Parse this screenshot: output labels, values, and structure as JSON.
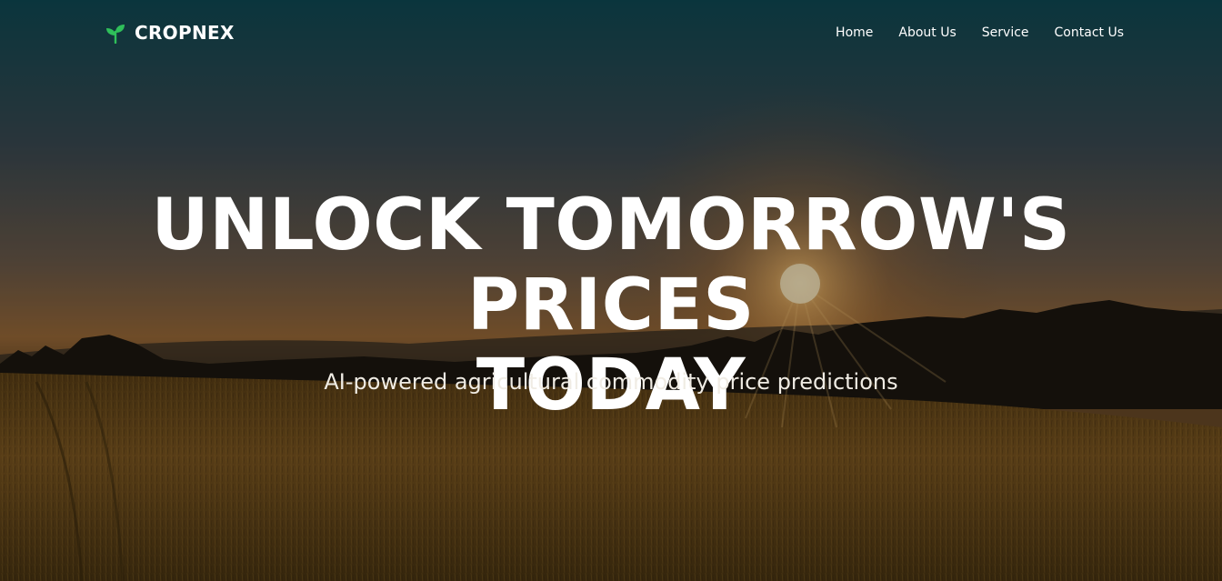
{
  "brand": {
    "name": "CROPNEX",
    "icon": "sprout-icon",
    "accent_color": "#2fbf5a"
  },
  "nav": {
    "items": [
      {
        "label": "Home"
      },
      {
        "label": "About Us"
      },
      {
        "label": "Service"
      },
      {
        "label": "Contact Us"
      }
    ]
  },
  "hero": {
    "headline_line1": "UNLOCK TOMORROW'S PRICES",
    "headline_line2": "TODAY",
    "subtitle": "AI-powered agricultural commodity price predictions",
    "background": "sunset-wheat-field-image"
  }
}
